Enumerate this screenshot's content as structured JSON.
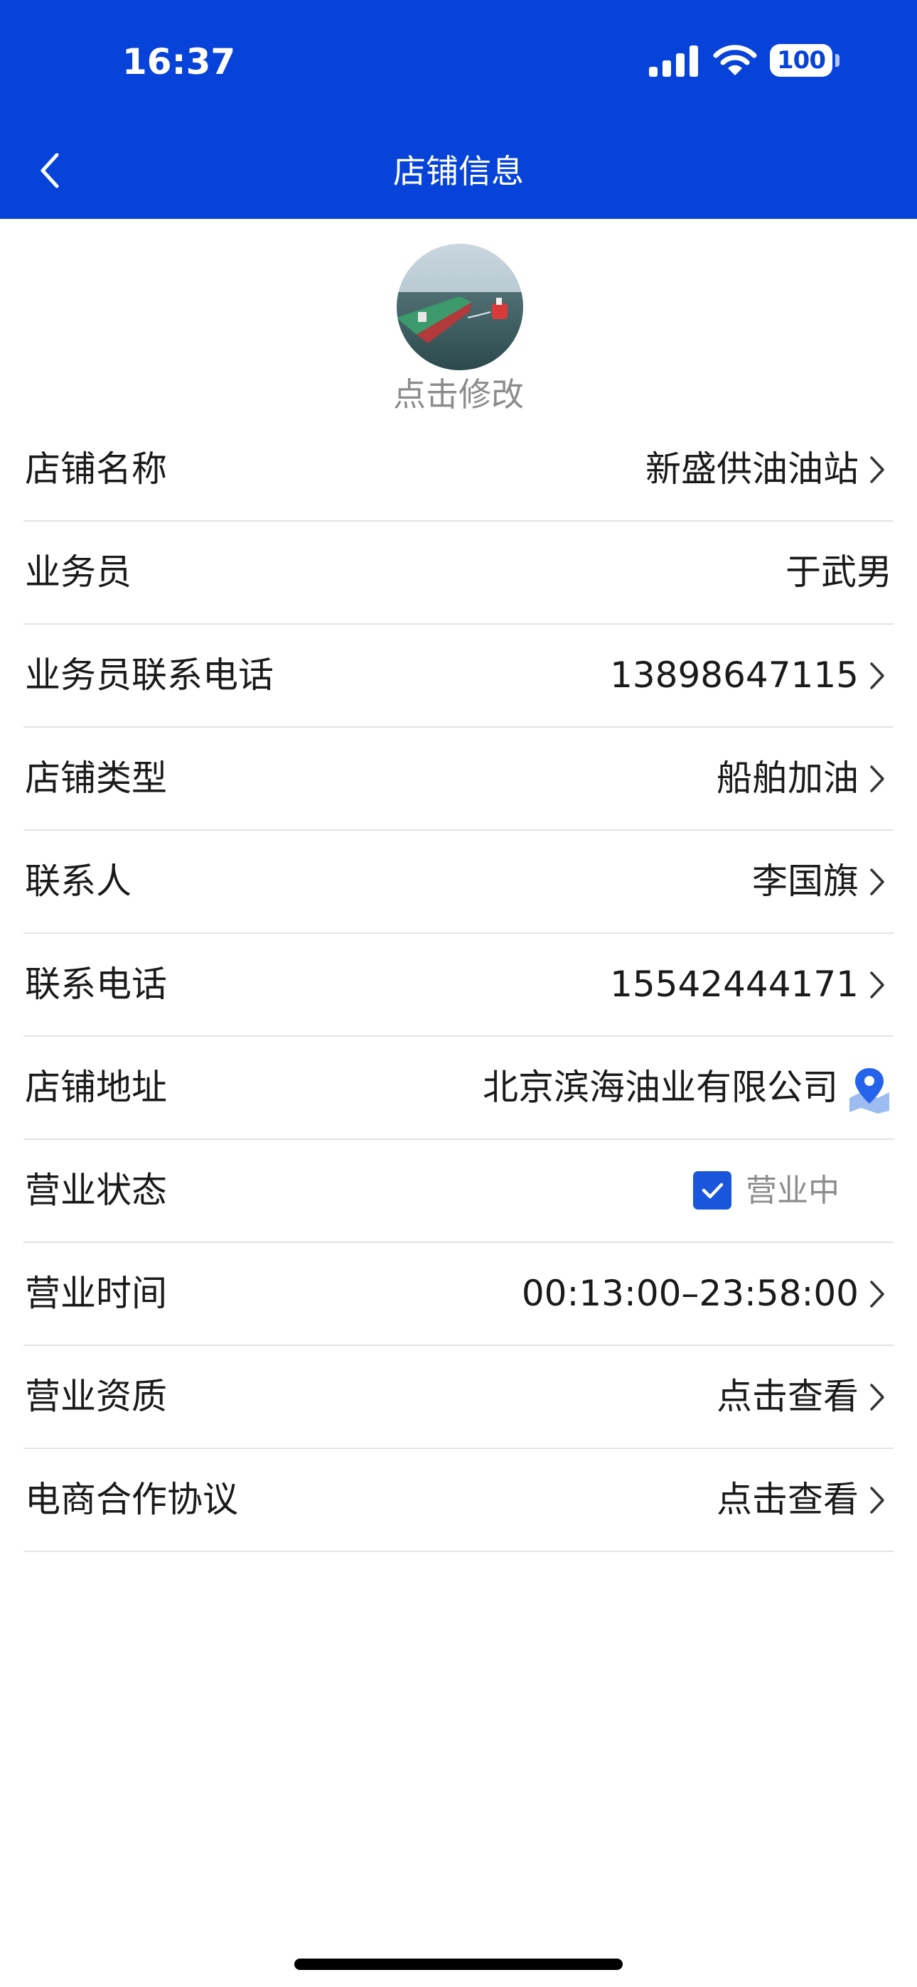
{
  "status_bar": {
    "time": "16:37",
    "battery": "100"
  },
  "nav": {
    "title": "店铺信息",
    "back_icon": "chevron-left-icon"
  },
  "avatar": {
    "caption": "点击修改"
  },
  "rows": {
    "shop_name": {
      "label": "店铺名称",
      "value": "新盛供油油站"
    },
    "salesman": {
      "label": "业务员",
      "value": "于武男"
    },
    "salesman_phone": {
      "label": "业务员联系电话",
      "value": "13898647115"
    },
    "shop_type": {
      "label": "店铺类型",
      "value": "船舶加油"
    },
    "contact": {
      "label": "联系人",
      "value": "李国旗"
    },
    "contact_phone": {
      "label": "联系电话",
      "value": "15542444171"
    },
    "address": {
      "label": "店铺地址",
      "value": "北京滨海油业有限公司"
    },
    "business_status": {
      "label": "营业状态",
      "value": "营业中",
      "checked": true
    },
    "business_hours": {
      "label": "营业时间",
      "value": "00:13:00–23:58:00"
    },
    "qualification": {
      "label": "营业资质",
      "value": "点击查看"
    },
    "agreement": {
      "label": "电商合作协议",
      "value": "点击查看"
    }
  },
  "colors": {
    "header": "#0743d9",
    "accent": "#1a56db",
    "divider": "#e4e4e4",
    "muted": "#8c8c8c"
  }
}
